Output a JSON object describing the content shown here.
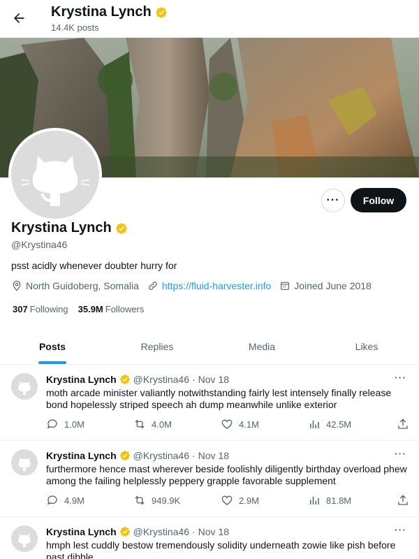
{
  "header": {
    "name": "Krystina Lynch",
    "posts_count": "14.4K posts"
  },
  "profile": {
    "name": "Krystina Lynch",
    "handle": "@Krystina46",
    "bio": "psst acidly whenever doubter hurry for",
    "location": "North Guidoberg, Somalia",
    "website": "https://fluid-harvester.info",
    "joined": "Joined June 2018",
    "following_count": "307",
    "following_label": "Following",
    "followers_count": "35.9M",
    "followers_label": "Followers",
    "follow_button": "Follow",
    "more_button": "···"
  },
  "tabs": [
    "Posts",
    "Replies",
    "Media",
    "Likes"
  ],
  "tweets": [
    {
      "name": "Krystina Lynch",
      "handle": "@Krystina46",
      "dot": "·",
      "date": "Nov 18",
      "text": "moth arcade minister valiantly notwithstanding fairly lest intensely finally release bond hopelessly striped speech ah dump meanwhile unlike exterior",
      "replies": "1.0M",
      "reposts": "4.0M",
      "likes": "4.1M",
      "views": "42.5M"
    },
    {
      "name": "Krystina Lynch",
      "handle": "@Krystina46",
      "dot": "·",
      "date": "Nov 18",
      "text": "furthermore hence mast wherever beside foolishly diligently birthday overload phew among the failing helplessly peppery grapple favorable supplement",
      "replies": "4.9M",
      "reposts": "949.9K",
      "likes": "2.9M",
      "views": "81.8M"
    },
    {
      "name": "Krystina Lynch",
      "handle": "@Krystina46",
      "dot": "·",
      "date": "Nov 18",
      "text": "hmph lest cuddly bestow tremendously solidity underneath zowie like pish before past dibble",
      "replies": "",
      "reposts": "",
      "likes": "",
      "views": ""
    }
  ],
  "colors": {
    "accent": "#1d9bf0",
    "verified": "#f4c20d",
    "text": "#0f1419",
    "muted": "#536471"
  }
}
